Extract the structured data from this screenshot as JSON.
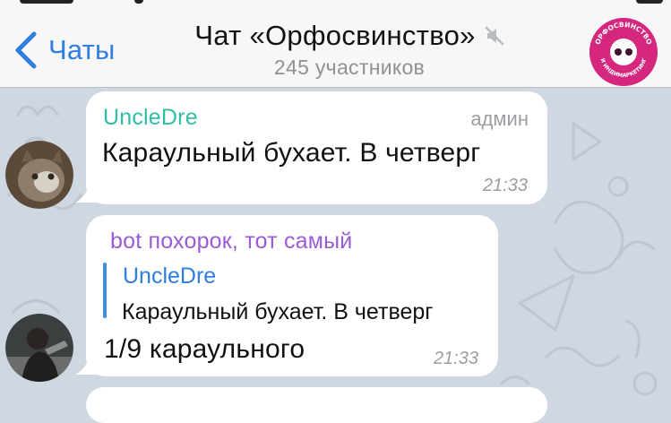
{
  "header": {
    "back_label": "Чаты",
    "title": "Чат «Орфосвинство»",
    "subtitle": "245 участников",
    "avatar_text_top": "ОРФОСВИНСТВО",
    "avatar_text_bottom": "И ИНДИМАРКЕТИНГ"
  },
  "colors": {
    "accent": "#2f7ee0",
    "sender_green": "#2dbfa6",
    "sender_purple": "#9a5bd6",
    "avatar_pink": "#d6277f"
  },
  "messages": [
    {
      "sender": "UncleDre",
      "role": "админ",
      "text": "Караульный бухает. В четверг",
      "time": "21:33"
    },
    {
      "sender": "bot похорок, тот самый",
      "reply_to_name": "UncleDre",
      "reply_to_text": "Караульный бухает. В четверг",
      "text": "1/9 караульного",
      "time": "21:33"
    }
  ],
  "icons": {
    "back": "chevron-left-icon",
    "mute": "muted-speaker-icon"
  }
}
